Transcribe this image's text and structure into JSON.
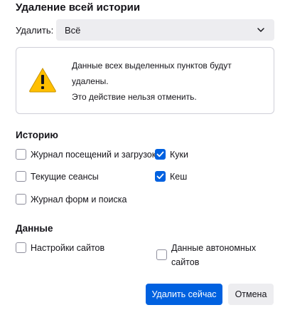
{
  "dialog": {
    "title": "Удаление всей истории",
    "range_label": "Удалить:",
    "range_value": "Всё"
  },
  "warning": {
    "line1": "Данные всех выделенных пунктов будут",
    "line2": "удалены.",
    "line3": "Это действие нельзя отменить."
  },
  "history": {
    "heading": "Историю",
    "items": [
      {
        "label": "Журнал посещений и загрузок",
        "checked": false
      },
      {
        "label": "Куки",
        "checked": true
      },
      {
        "label": "Текущие сеансы",
        "checked": false
      },
      {
        "label": "Кеш",
        "checked": true
      },
      {
        "label": "Журнал форм и поиска",
        "checked": false
      }
    ]
  },
  "data_section": {
    "heading": "Данные",
    "items": [
      {
        "label": "Настройки сайтов",
        "checked": false
      },
      {
        "label_line1": "Данные автономных",
        "label_line2": "сайтов",
        "checked": false
      }
    ]
  },
  "buttons": {
    "clear_now": "Удалить сейчас",
    "cancel": "Отмена"
  },
  "colors": {
    "accent": "#0061e0",
    "warning": "#ffbf00"
  }
}
